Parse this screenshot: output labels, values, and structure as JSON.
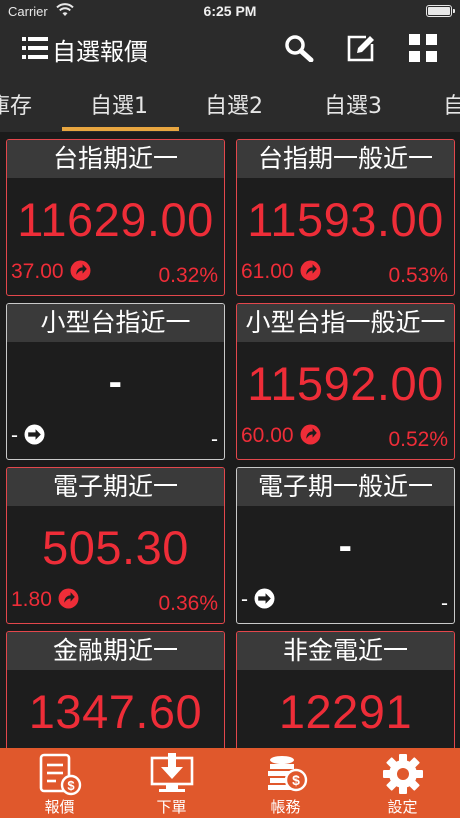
{
  "status_bar": {
    "carrier": "Carrier",
    "time": "6:25 PM",
    "battery_level": 1.0
  },
  "header": {
    "title": "自選報價",
    "icons": [
      "menu-icon",
      "search-icon",
      "edit-icon",
      "grid-icon"
    ]
  },
  "tabs": [
    {
      "label": "庫存",
      "selected": false
    },
    {
      "label": "自選1",
      "selected": true
    },
    {
      "label": "自選2",
      "selected": false
    },
    {
      "label": "自選3",
      "selected": false
    },
    {
      "label": "自",
      "selected": false
    }
  ],
  "quotes": [
    {
      "name": "台指期近一",
      "price": "11629.00",
      "change": "37.00",
      "percent": "0.32%",
      "direction": "up"
    },
    {
      "name": "台指期一般近一",
      "price": "11593.00",
      "change": "61.00",
      "percent": "0.53%",
      "direction": "up"
    },
    {
      "name": "小型台指近一",
      "price": "-",
      "change": "-",
      "percent": "-",
      "direction": "flat"
    },
    {
      "name": "小型台指一般近一",
      "price": "11592.00",
      "change": "60.00",
      "percent": "0.52%",
      "direction": "up"
    },
    {
      "name": "電子期近一",
      "price": "505.30",
      "change": "1.80",
      "percent": "0.36%",
      "direction": "up"
    },
    {
      "name": "電子期一般近一",
      "price": "-",
      "change": "-",
      "percent": "-",
      "direction": "flat"
    },
    {
      "name": "金融期近一",
      "price": "1347.60",
      "change": "",
      "percent": "",
      "direction": "up"
    },
    {
      "name": "非金電近一",
      "price": "12291",
      "change": "",
      "percent": "",
      "direction": "up"
    }
  ],
  "tabbar": [
    {
      "label": "報價",
      "icon": "quote-document-icon"
    },
    {
      "label": "下單",
      "icon": "order-download-icon"
    },
    {
      "label": "帳務",
      "icon": "coins-account-icon"
    },
    {
      "label": "設定",
      "icon": "gear-icon"
    }
  ],
  "colors": {
    "up": "#ee2d38",
    "flat": "#ffffff",
    "accent": "#e8a640",
    "tabbar": "#e0582c",
    "background": "#1b1b1b"
  }
}
